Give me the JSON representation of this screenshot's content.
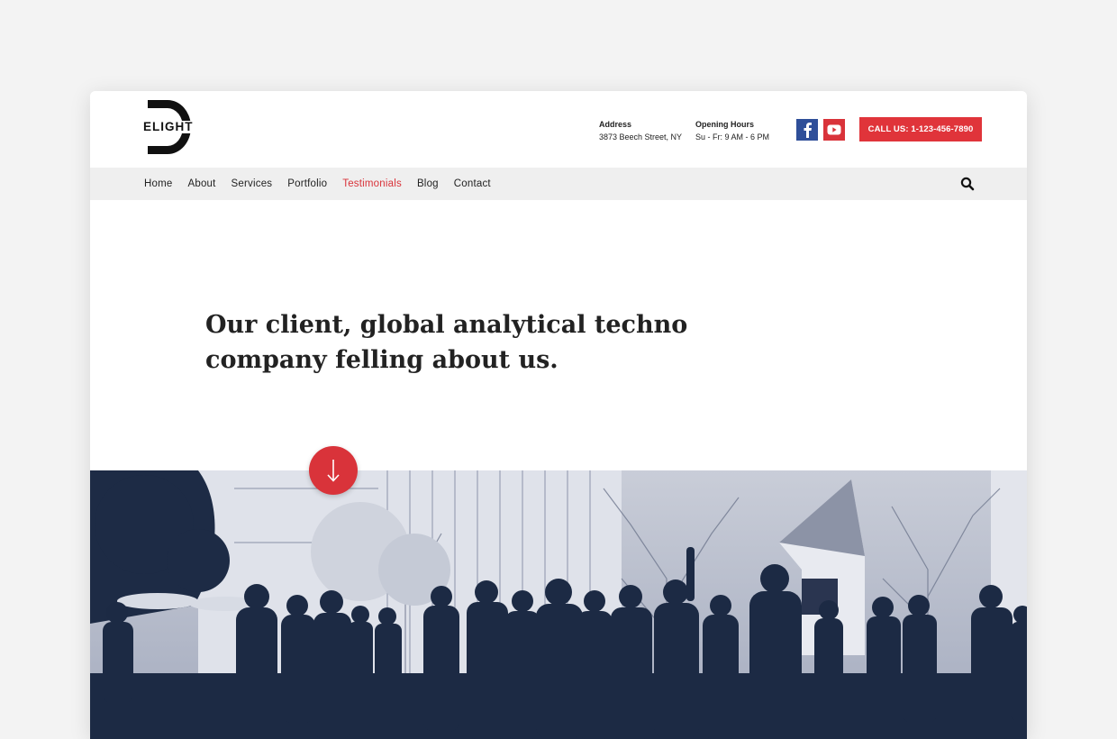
{
  "brand": {
    "logo_letter": "D",
    "logo_word": "ELIGHT"
  },
  "header": {
    "address_label": "Address",
    "address_value": "3873 Beech Street, NY",
    "hours_label": "Opening Hours",
    "hours_value": "Su - Fr: 9 AM - 6 PM",
    "cta_label": "CALL US: 1-123-456-7890"
  },
  "social": [
    {
      "name": "facebook-icon",
      "glyph": "f",
      "color": "#2f4f99"
    },
    {
      "name": "youtube-icon",
      "color": "#d9333a"
    }
  ],
  "nav": {
    "items": [
      {
        "label": "Home",
        "active": false
      },
      {
        "label": "About",
        "active": false
      },
      {
        "label": "Services",
        "active": false
      },
      {
        "label": "Portfolio",
        "active": false
      },
      {
        "label": "Testimonials",
        "active": true
      },
      {
        "label": "Blog",
        "active": false
      },
      {
        "label": "Contact",
        "active": false
      }
    ],
    "search_icon": "search-icon"
  },
  "hero": {
    "title_line1": "Our client, global analytical techno",
    "title_line2": "company felling about us."
  },
  "scroll_button": {
    "icon": "arrow-down-icon"
  },
  "colors": {
    "accent": "#d9333a",
    "facebook": "#2f4f99",
    "nav_bg": "#efefef",
    "photo_tint": "#1c2a44"
  }
}
